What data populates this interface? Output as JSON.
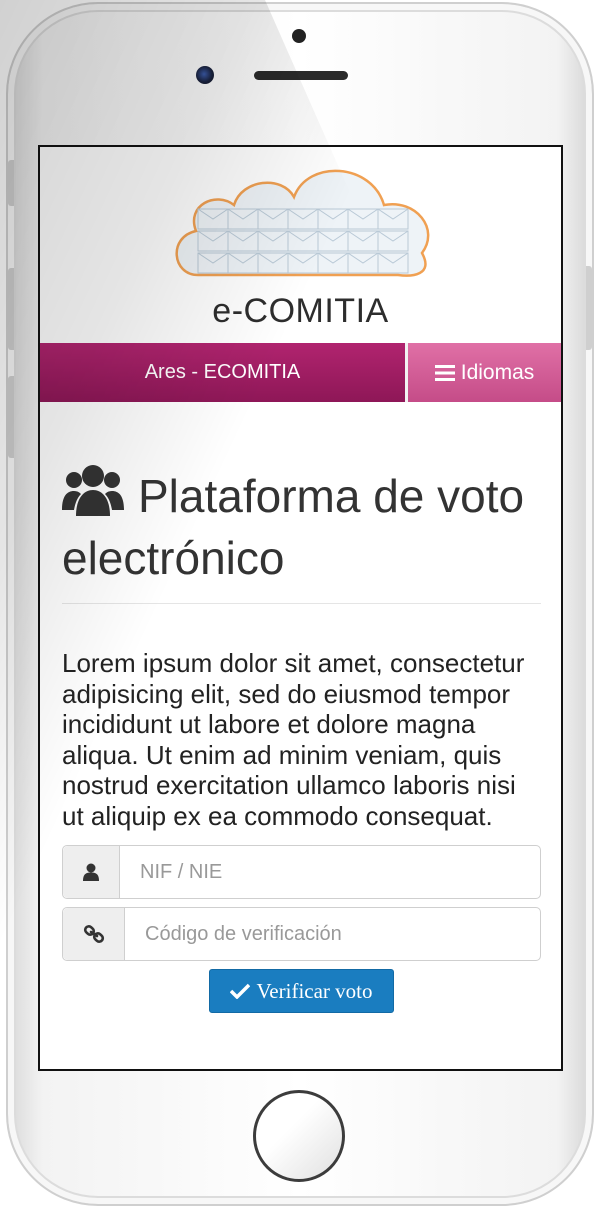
{
  "header": {
    "logo_text": "e-COMITIA"
  },
  "navbar": {
    "brand_label": "Ares - ECOMITIA",
    "languages_label": "Idiomas"
  },
  "main": {
    "title": "Plataforma de voto electrónico",
    "description": "Lorem ipsum dolor sit amet, consectetur adipisicing elit, sed do eiusmod tempor incididunt ut labore et dolore magna aliqua. Ut enim ad minim veniam, quis nostrud exercitation ullamco laboris nisi ut aliquip ex ea commodo consequat."
  },
  "form": {
    "nif_placeholder": "NIF / NIE",
    "nif_value": "",
    "code_placeholder": "Código de verificación",
    "code_value": "",
    "verify_label": "Verificar voto"
  },
  "icons": {
    "brand_colors": {
      "primary": "#a31f66",
      "secondary": "#d0609a",
      "button": "#1a7dc0"
    },
    "user_group": "users-icon",
    "user": "user-icon",
    "link": "link-icon",
    "check": "check-icon",
    "menu": "menu-icon"
  }
}
